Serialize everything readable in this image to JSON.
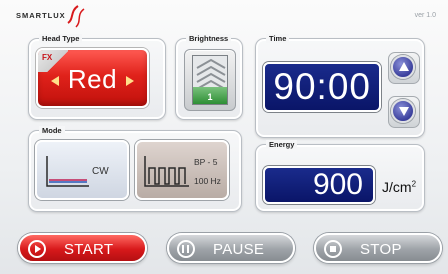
{
  "brand": {
    "logo_text": "SMARTLUX",
    "version": "ver 1.0"
  },
  "head_type": {
    "title": "Head Type",
    "corner_label": "FX",
    "value": "Red"
  },
  "brightness": {
    "title": "Brightness",
    "level": "1"
  },
  "time": {
    "title": "Time",
    "value": "90:00"
  },
  "mode": {
    "title": "Mode",
    "cw_label": "CW",
    "bp_label": "BP - 5",
    "hz_label": "100  Hz"
  },
  "energy": {
    "title": "Energy",
    "value": "900",
    "unit": "J/cm",
    "unit_sup": "2"
  },
  "controls": {
    "start": "START",
    "pause": "PAUSE",
    "stop": "STOP"
  },
  "colors": {
    "accent_red": "#d8191b",
    "lcd_blue": "#0a1568",
    "active_green": "#2e8f35"
  },
  "icons": [
    "swoosh-icon",
    "left-arrow-icon",
    "right-arrow-icon",
    "chevron-stack-icon",
    "up-arrow-icon",
    "down-arrow-icon",
    "cw-graph-icon",
    "pulse-graph-icon",
    "play-icon",
    "pause-icon",
    "stop-icon"
  ]
}
